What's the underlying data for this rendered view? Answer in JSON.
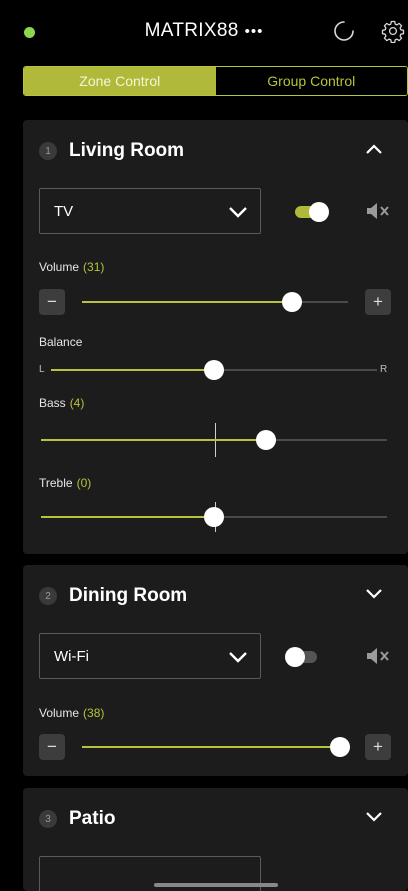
{
  "colors": {
    "accent": "#b8c23a",
    "status_green": "#8bd650",
    "card_bg": "#1c1c1c"
  },
  "header": {
    "title": "MATRIX88",
    "menu_dots": "•••",
    "status_icon": "status-dot",
    "refresh_icon": "refresh-icon",
    "settings_icon": "gear-icon"
  },
  "tabs": [
    {
      "label": "Zone Control",
      "active": true
    },
    {
      "label": "Group Control",
      "active": false
    }
  ],
  "zones": [
    {
      "number": "1",
      "name": "Living Room",
      "expanded": true,
      "source": "TV",
      "power_on": true,
      "volume_label": "Volume",
      "volume_value": "(31)",
      "volume_level": 0.79,
      "decrement": "−",
      "increment": "+",
      "balance_label": "Balance",
      "balance_left": "L",
      "balance_right": "R",
      "balance_level": 0.5,
      "bass_label": "Bass",
      "bass_value": "(4)",
      "bass_level": 0.65,
      "treble_label": "Treble",
      "treble_value": "(0)",
      "treble_level": 0.5
    },
    {
      "number": "2",
      "name": "Dining Room",
      "expanded": false,
      "source": "Wi-Fi",
      "power_on": false,
      "volume_label": "Volume",
      "volume_value": "(38)",
      "volume_level": 0.97,
      "decrement": "−",
      "increment": "+"
    },
    {
      "number": "3",
      "name": "Patio",
      "expanded": false
    }
  ]
}
